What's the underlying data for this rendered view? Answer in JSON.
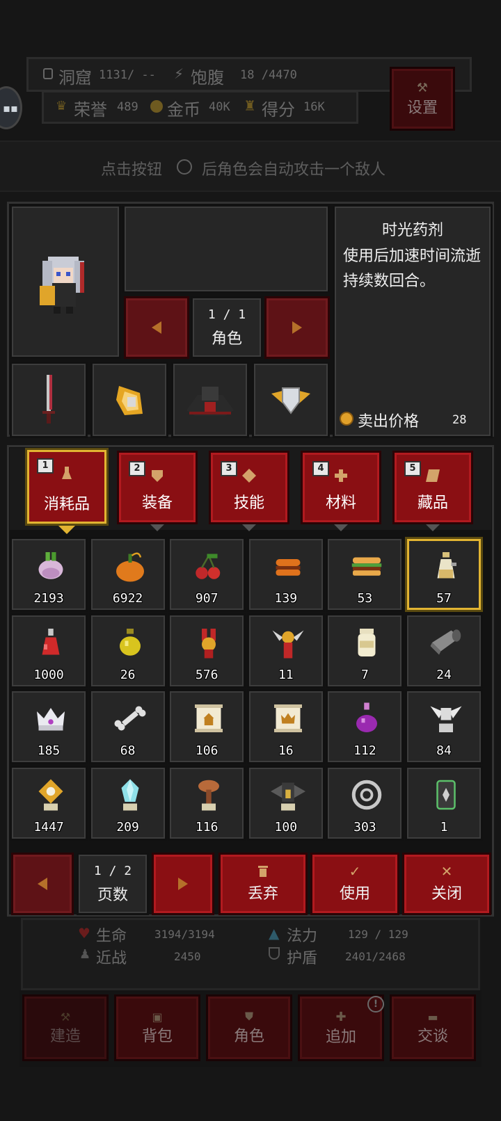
{
  "hud": {
    "cave_label": "洞窟",
    "cave_value": "1131/ --",
    "satiety_label": "饱腹",
    "satiety_value": "18 /4470",
    "honor_label": "荣誉",
    "honor_value": "489",
    "gold_label": "金币",
    "gold_value": "40K",
    "score_label": "得分",
    "score_value": "16K",
    "settings_label": "设置"
  },
  "hint": {
    "before": "点击按钮",
    "after": "后角色会自动攻击一个敌人"
  },
  "character": {
    "page": "1 / 1",
    "type_label": "角色"
  },
  "item_detail": {
    "name": "时光药剂",
    "description": "使用后加速时间流逝持续数回合。",
    "sell_label": "卖出价格",
    "sell_value": "28"
  },
  "tabs": [
    {
      "num": "1",
      "label": "消耗品",
      "icon": "flask-icon"
    },
    {
      "num": "2",
      "label": "装备",
      "icon": "shield-icon"
    },
    {
      "num": "3",
      "label": "技能",
      "icon": "diamond-icon"
    },
    {
      "num": "4",
      "label": "材料",
      "icon": "plus-icon"
    },
    {
      "num": "5",
      "label": "藏品",
      "icon": "scroll-icon"
    }
  ],
  "inventory": [
    {
      "icon": "turnip-icon",
      "count": "2193"
    },
    {
      "icon": "pumpkin-icon",
      "count": "6922"
    },
    {
      "icon": "cherry-icon",
      "count": "907"
    },
    {
      "icon": "burger-icon",
      "count": "139"
    },
    {
      "icon": "sandwich-icon",
      "count": "53"
    },
    {
      "icon": "time-potion-icon",
      "count": "57"
    },
    {
      "icon": "red-potion-icon",
      "count": "1000"
    },
    {
      "icon": "yellow-potion-icon",
      "count": "26"
    },
    {
      "icon": "medal-icon",
      "count": "576"
    },
    {
      "icon": "winged-medal-icon",
      "count": "11"
    },
    {
      "icon": "jar-icon",
      "count": "7"
    },
    {
      "icon": "cloth-roll-icon",
      "count": "24"
    },
    {
      "icon": "crown-icon",
      "count": "185"
    },
    {
      "icon": "bone-icon",
      "count": "68"
    },
    {
      "icon": "scroll-house-icon",
      "count": "106"
    },
    {
      "icon": "scroll-crown-icon",
      "count": "16"
    },
    {
      "icon": "purple-potion-icon",
      "count": "112"
    },
    {
      "icon": "angel-statue-icon",
      "count": "84"
    },
    {
      "icon": "gold-relic-icon",
      "count": "1447"
    },
    {
      "icon": "crystal-icon",
      "count": "209"
    },
    {
      "icon": "tree-relic-icon",
      "count": "116"
    },
    {
      "icon": "bat-statue-icon",
      "count": "100"
    },
    {
      "icon": "target-icon",
      "count": "303"
    },
    {
      "icon": "card-icon",
      "count": "1"
    }
  ],
  "pager": {
    "page": "1 / 2",
    "label": "页数"
  },
  "actions": {
    "discard": "丢弃",
    "use": "使用",
    "close": "关闭"
  },
  "stats": {
    "hp_label": "生命",
    "hp_value": "3194/3194",
    "mp_label": "法力",
    "mp_value": "129 / 129",
    "melee_label": "近战",
    "melee_value": "2450",
    "shield_label": "护盾",
    "shield_value": "2401/2468"
  },
  "bottom_nav": {
    "build": "建造",
    "bag": "背包",
    "role": "角色",
    "add": "追加",
    "talk": "交谈"
  }
}
